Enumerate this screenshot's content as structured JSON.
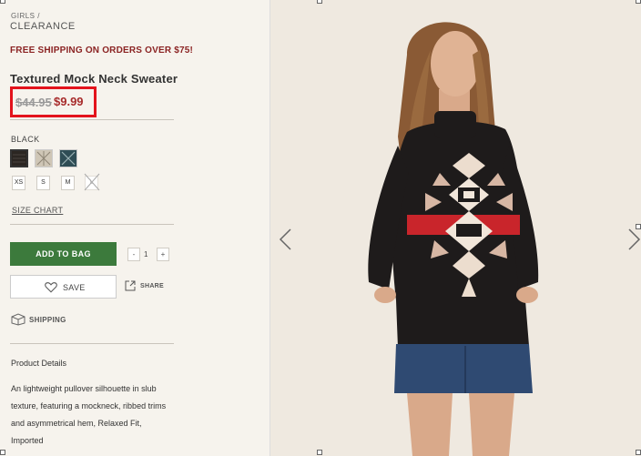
{
  "breadcrumb": {
    "parent": "GIRLS",
    "separator": "/",
    "current": "CLEARANCE"
  },
  "promo": "FREE SHIPPING ON ORDERS OVER $75!",
  "product": {
    "name": "Textured Mock Neck Sweater",
    "old_price": "$44.95",
    "sale_price": "$9.99",
    "color_label": "BLACK",
    "swatches": [
      {
        "name": "black",
        "color": "#2b2622"
      },
      {
        "name": "cream",
        "color": "#cfc6b6"
      },
      {
        "name": "teal",
        "color": "#2f4d55"
      }
    ],
    "sizes": [
      "XS",
      "S",
      "M",
      "L"
    ],
    "size_chart": "SIZE CHART",
    "add_to_bag": "ADD TO BAG",
    "qty_minus": "-",
    "qty": "1",
    "qty_plus": "+",
    "save": "SAVE",
    "share": "SHARE",
    "shipping": "SHIPPING",
    "details_title": "Product Details",
    "description_lines": [
      "An lightweight pullover silhouette in slub",
      "texture, featuring a mockneck, ribbed trims",
      "and asymmetrical hem, Relaxed Fit,",
      "Imported"
    ]
  },
  "colors": {
    "promo": "#8b2323",
    "sale": "#a72b2b",
    "cta": "#3c7a3c",
    "highlight": "#e3131c"
  },
  "icons": [
    "heart-icon",
    "share-icon",
    "shipping-box-icon",
    "chevron-left-icon",
    "chevron-right-icon"
  ]
}
